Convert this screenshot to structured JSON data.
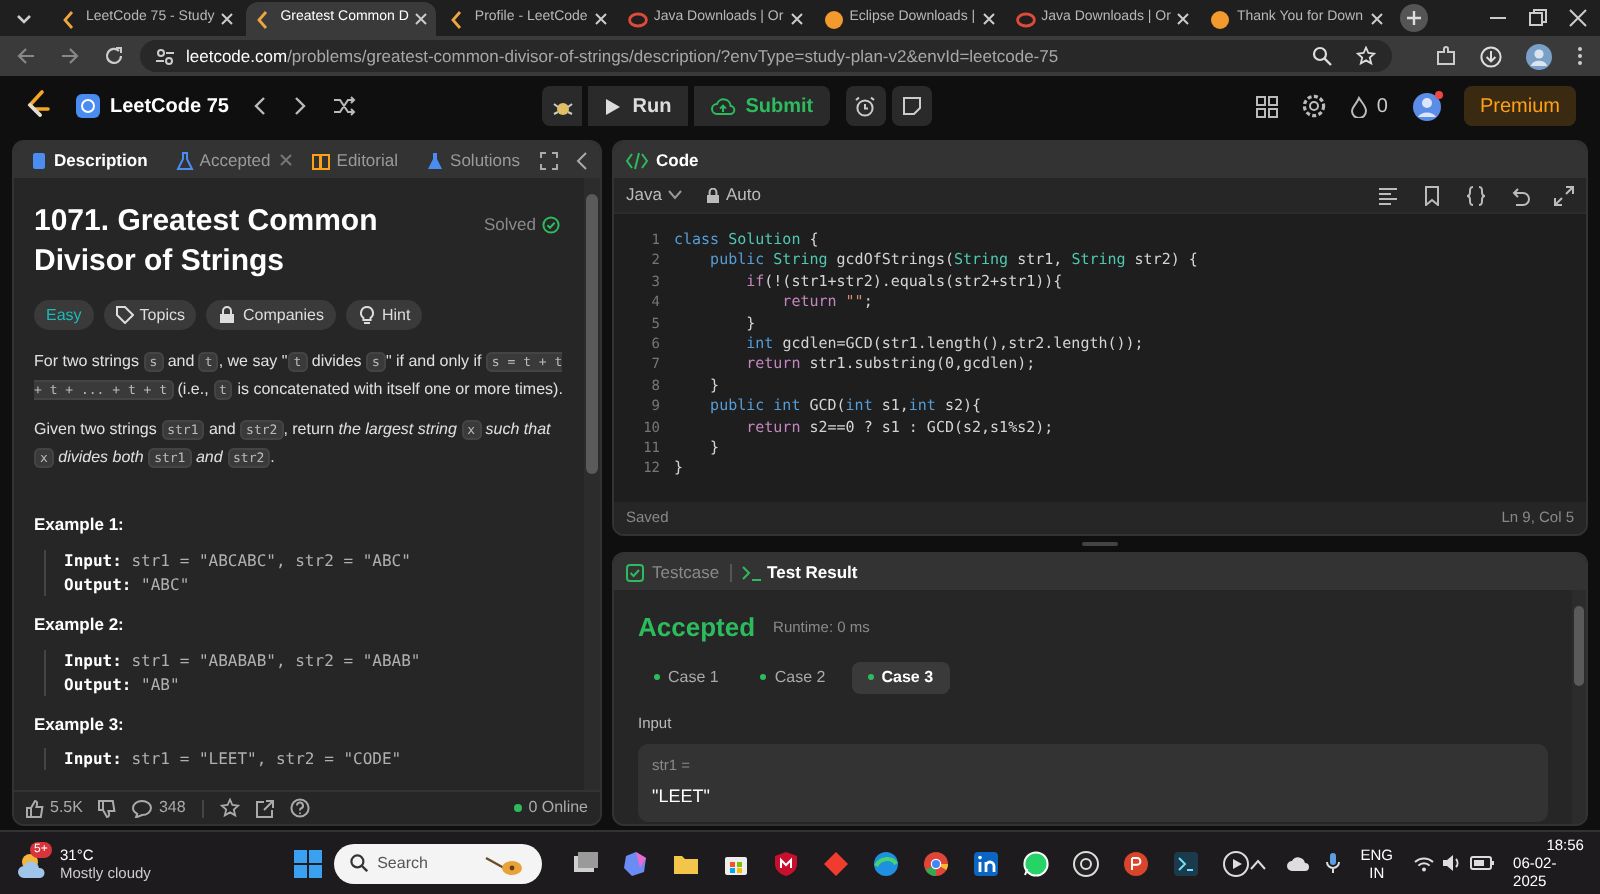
{
  "browser": {
    "tabs": [
      {
        "title": "LeetCode 75 - Study",
        "kind": "leetcode",
        "selected": false
      },
      {
        "title": "Greatest Common D",
        "kind": "leetcode",
        "selected": true
      },
      {
        "title": "Profile - LeetCode",
        "kind": "leetcode",
        "selected": false
      },
      {
        "title": "Java Downloads | Or",
        "kind": "oracle",
        "selected": false
      },
      {
        "title": "Eclipse Downloads |",
        "kind": "eclipse",
        "selected": false
      },
      {
        "title": "Java Downloads | Or",
        "kind": "oracle",
        "selected": false
      },
      {
        "title": "Thank You for Down",
        "kind": "eclipse",
        "selected": false
      }
    ],
    "address": {
      "host": "leetcode.com",
      "path": "/problems/greatest-common-divisor-of-strings/description/?envType=study-plan-v2&envId=leetcode-75"
    }
  },
  "nav": {
    "study_plan": "LeetCode 75",
    "run": "Run",
    "submit": "Submit",
    "streak": "0",
    "premium": "Premium"
  },
  "problem_panel": {
    "tabs": [
      {
        "label": "Description",
        "selected": true
      },
      {
        "label": "Accepted",
        "selected": false
      },
      {
        "label": "Editorial",
        "selected": false
      },
      {
        "label": "Solutions",
        "selected": false
      }
    ],
    "title": "1071. Greatest Common Divisor of Strings",
    "status": "Solved",
    "tags": [
      {
        "label": "Easy",
        "kind": "difficulty"
      },
      {
        "label": "Topics",
        "kind": "topics"
      },
      {
        "label": "Companies",
        "kind": "companies"
      },
      {
        "label": "Hint",
        "kind": "hint"
      }
    ],
    "paragraphs": [
      [
        {
          "text": "For two strings ",
          "kind": "text"
        },
        {
          "text": "s",
          "kind": "code"
        },
        {
          "text": " and ",
          "kind": "text"
        },
        {
          "text": "t",
          "kind": "code"
        },
        {
          "text": ", we say \"",
          "kind": "text"
        },
        {
          "text": "t",
          "kind": "code"
        },
        {
          "text": " divides ",
          "kind": "text"
        },
        {
          "text": "s",
          "kind": "code"
        },
        {
          "text": "\" if and only if ",
          "kind": "text"
        },
        {
          "text": "s = t + t + t + ... + t + t",
          "kind": "code"
        },
        {
          "text": " (i.e., ",
          "kind": "text"
        },
        {
          "text": "t",
          "kind": "code"
        },
        {
          "text": " is concatenated with itself one or more times).",
          "kind": "text"
        }
      ],
      [
        {
          "text": "Given two strings ",
          "kind": "text"
        },
        {
          "text": "str1",
          "kind": "code"
        },
        {
          "text": " and ",
          "kind": "text"
        },
        {
          "text": "str2",
          "kind": "code"
        },
        {
          "text": ", return ",
          "kind": "text"
        },
        {
          "text": "the largest string ",
          "kind": "italic"
        },
        {
          "text": "x",
          "kind": "code"
        },
        {
          "text": " such that ",
          "kind": "italic"
        },
        {
          "text": "x",
          "kind": "code"
        },
        {
          "text": " divides both ",
          "kind": "italic"
        },
        {
          "text": "str1",
          "kind": "code"
        },
        {
          "text": " and ",
          "kind": "italic"
        },
        {
          "text": "str2",
          "kind": "code"
        },
        {
          "text": ".",
          "kind": "text"
        }
      ]
    ],
    "examples": [
      {
        "title": "Example 1:",
        "rows": [
          {
            "label": "Input:",
            "value": "str1 = \"ABCABC\", str2 = \"ABC\""
          },
          {
            "label": "Output:",
            "value": "\"ABC\""
          }
        ]
      },
      {
        "title": "Example 2:",
        "rows": [
          {
            "label": "Input:",
            "value": "str1 = \"ABABAB\", str2 = \"ABAB\""
          },
          {
            "label": "Output:",
            "value": "\"AB\""
          }
        ]
      },
      {
        "title": "Example 3:",
        "rows": [
          {
            "label": "Input:",
            "value": "str1 = \"LEET\", str2 = \"CODE\""
          }
        ]
      }
    ],
    "footer": {
      "likes": "5.5K",
      "comments": "348",
      "online": "0 Online"
    }
  },
  "code_panel": {
    "title": "Code",
    "language": "Java",
    "mode": "Auto",
    "lines": [
      {
        "number": "1",
        "tokens": [
          {
            "text": "class ",
            "kind": "keyword"
          },
          {
            "text": "Solution",
            "kind": "type"
          },
          {
            "text": " {",
            "kind": "plain"
          }
        ]
      },
      {
        "number": "2",
        "tokens": [
          {
            "text": "    public ",
            "kind": "keyword"
          },
          {
            "text": "String",
            "kind": "type"
          },
          {
            "text": " gcdOfStrings(",
            "kind": "plain"
          },
          {
            "text": "String",
            "kind": "type"
          },
          {
            "text": " str1, ",
            "kind": "plain"
          },
          {
            "text": "String",
            "kind": "type"
          },
          {
            "text": " str2) {",
            "kind": "plain"
          }
        ]
      },
      {
        "number": "3",
        "tokens": [
          {
            "text": "        if",
            "kind": "control"
          },
          {
            "text": "(!(str1+str2).equals(str2+str1)){",
            "kind": "plain"
          }
        ]
      },
      {
        "number": "4",
        "tokens": [
          {
            "text": "            return ",
            "kind": "control"
          },
          {
            "text": "\"\"",
            "kind": "string"
          },
          {
            "text": ";",
            "kind": "plain"
          }
        ]
      },
      {
        "number": "5",
        "tokens": [
          {
            "text": "        }",
            "kind": "plain"
          }
        ]
      },
      {
        "number": "6",
        "tokens": [
          {
            "text": "        int ",
            "kind": "keyword"
          },
          {
            "text": "gcdlen=GCD(str1.length(),str2.length());",
            "kind": "plain"
          }
        ]
      },
      {
        "number": "7",
        "tokens": [
          {
            "text": "        return ",
            "kind": "control"
          },
          {
            "text": "str1.substring(0,gcdlen);",
            "kind": "plain"
          }
        ]
      },
      {
        "number": "8",
        "tokens": [
          {
            "text": "    }",
            "kind": "plain"
          }
        ]
      },
      {
        "number": "9",
        "tokens": [
          {
            "text": "    public ",
            "kind": "keyword"
          },
          {
            "text": "int ",
            "kind": "keyword"
          },
          {
            "text": "GCD(",
            "kind": "plain"
          },
          {
            "text": "int ",
            "kind": "keyword"
          },
          {
            "text": "s1,",
            "kind": "plain"
          },
          {
            "text": "int ",
            "kind": "keyword"
          },
          {
            "text": "s2){",
            "kind": "plain"
          }
        ]
      },
      {
        "number": "10",
        "tokens": [
          {
            "text": "        return ",
            "kind": "control"
          },
          {
            "text": "s2==0 ? s1 : GCD(s2,s1%s2);",
            "kind": "plain"
          }
        ]
      },
      {
        "number": "11",
        "tokens": [
          {
            "text": "    }",
            "kind": "plain"
          }
        ]
      },
      {
        "number": "12",
        "tokens": [
          {
            "text": "}",
            "kind": "plain"
          }
        ]
      }
    ],
    "status": "Saved",
    "cursor": "Ln 9, Col 5"
  },
  "test_panel": {
    "tabs": [
      {
        "label": "Testcase",
        "selected": false
      },
      {
        "label": "Test Result",
        "selected": true
      }
    ],
    "verdict": "Accepted",
    "runtime": "Runtime: 0 ms",
    "cases": [
      {
        "label": "Case 1",
        "selected": false
      },
      {
        "label": "Case 2",
        "selected": false
      },
      {
        "label": "Case 3",
        "selected": true
      }
    ],
    "input_label": "Input",
    "param": "str1 =",
    "value": "\"LEET\""
  },
  "taskbar": {
    "temperature": "31°C",
    "weather": "Mostly cloudy",
    "badge": "5+",
    "search": "Search",
    "language": "ENG",
    "region": "IN",
    "time": "18:56",
    "date": "06-02-2025"
  }
}
